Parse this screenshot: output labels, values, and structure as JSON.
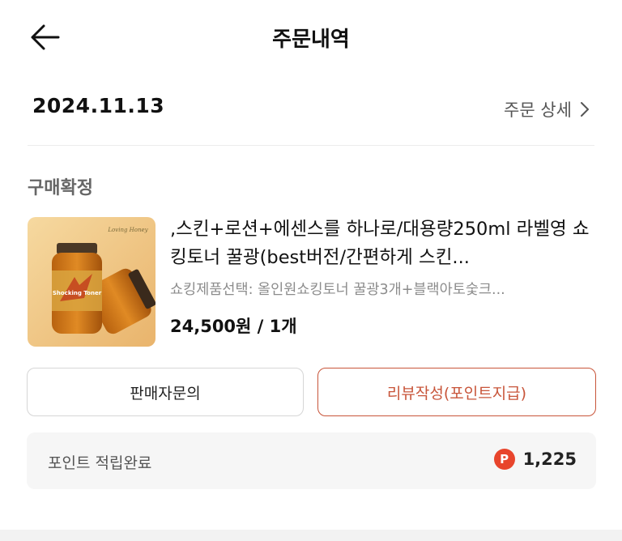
{
  "header": {
    "title": "주문내역"
  },
  "order": {
    "date": "2024.11.13",
    "detail_link": "주문 상세"
  },
  "status": "구매확정",
  "product": {
    "thumb_brand": "Loving Honey",
    "thumb_label": "Shocking Toner",
    "name": ",스킨+로션+에센스를 하나로/대용량250ml 라벨영 쇼킹토너 꿀광(best버전/간편하게 스킨...",
    "option": "쇼킹제품선택: 올인원쇼킹토너 꿀광3개+블랙아토숯크...",
    "price": "24,500원 / 1개"
  },
  "buttons": {
    "inquiry": "판매자문의",
    "review": "리뷰작성(포인트지급)"
  },
  "points": {
    "label": "포인트 적립완료",
    "badge": "P",
    "value": "1,225"
  },
  "colors": {
    "accent": "#c8553a",
    "point_badge": "#e8452c"
  }
}
